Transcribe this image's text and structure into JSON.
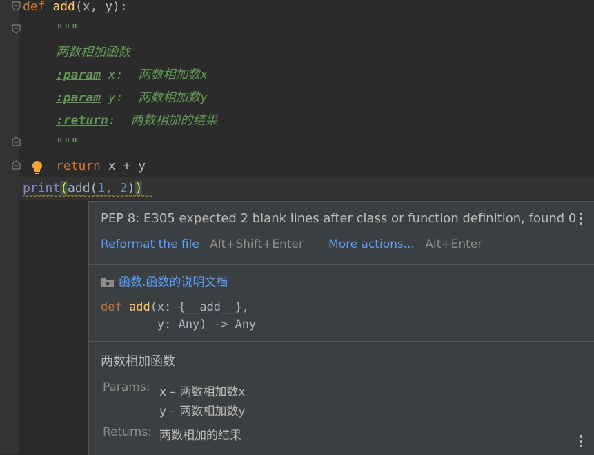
{
  "editor": {
    "lines": {
      "l1": {
        "kw": "def",
        "fn": "add",
        "rest": "(x, y):"
      },
      "l2": "\"\"\"",
      "l3": "两数相加函数",
      "l4": {
        "tag": ":param",
        "text": " x:  两数相加数x"
      },
      "l5": {
        "tag": ":param",
        "text": " y:  两数相加数y"
      },
      "l6": {
        "tag": ":return",
        "text": ":  两数相加的结果"
      },
      "l7": "\"\"\"",
      "l8": {
        "kw": "return",
        "rest": " x + y"
      },
      "l9": {
        "fn": "print",
        "open": "(",
        "call": "add(",
        "n1": "1",
        "comma": ", ",
        "n2": "2",
        "close1": ")",
        "close2": ")"
      }
    }
  },
  "popup": {
    "inspection": "PEP 8: E305 expected 2 blank lines after class or function definition, found 0",
    "actions": [
      {
        "label": "Reformat the file",
        "shortcut": "Alt+Shift+Enter"
      },
      {
        "label": "More actions...",
        "shortcut": "Alt+Enter"
      }
    ],
    "module": "函数.函数的说明文档",
    "signature": {
      "line1_kw": "def",
      "line1_fn": "add",
      "line1_rest": "(x: {__add__},",
      "line2": "        y: Any) -> Any"
    },
    "description": "两数相加函数",
    "params_label": "Params:",
    "params": [
      "x – 两数相加数x",
      "y – 两数相加数y"
    ],
    "returns_label": "Returns:",
    "returns": "两数相加的结果"
  },
  "colors": {
    "background": "#2b2b2b",
    "keyword": "#cc7832",
    "function": "#ffc66d",
    "number": "#6897bb",
    "docstring": "#629755",
    "link": "#589df6",
    "popup": "#3c3f41"
  }
}
